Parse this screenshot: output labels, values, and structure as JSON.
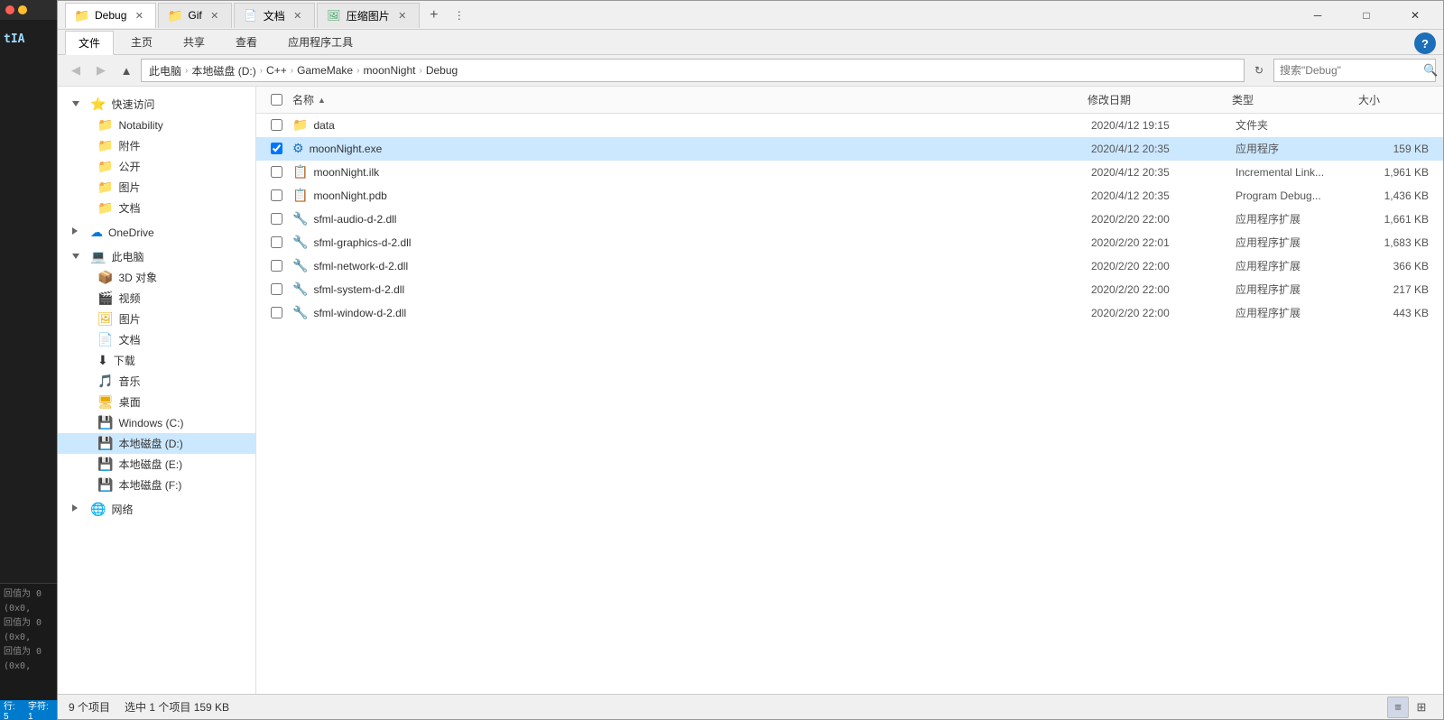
{
  "window": {
    "title": "Debug",
    "tabs": [
      {
        "label": "Debug",
        "type": "folder",
        "active": true
      },
      {
        "label": "Gif",
        "type": "folder",
        "active": false
      },
      {
        "label": "文档",
        "type": "doc",
        "active": false
      },
      {
        "label": "压缩图片",
        "type": "img",
        "active": false
      }
    ],
    "controls": {
      "minimize": "─",
      "maximize": "□",
      "close": "✕"
    }
  },
  "ribbon": {
    "tabs": [
      "文件",
      "主页",
      "共享",
      "查看",
      "应用程序工具"
    ],
    "active_tab": "文件",
    "help_icon": "?"
  },
  "address_bar": {
    "path": "此电脑 › 本地磁盘 (D:) › C++ › GameMake › moonNight › Debug",
    "path_parts": [
      "此电脑",
      "本地磁盘 (D:)",
      "C++",
      "GameMake",
      "moonNight",
      "Debug"
    ],
    "search_placeholder": "搜索\"Debug\""
  },
  "sidebar": {
    "quick_access_label": "快速访问",
    "onedrive_label": "OneDrive",
    "items": [
      {
        "label": "快速访问",
        "type": "quick-access",
        "level": 0,
        "expanded": true
      },
      {
        "label": "Notability",
        "type": "folder",
        "level": 1
      },
      {
        "label": "附件",
        "type": "folder",
        "level": 1
      },
      {
        "label": "公开",
        "type": "folder",
        "level": 1
      },
      {
        "label": "图片",
        "type": "folder",
        "level": 1
      },
      {
        "label": "文档",
        "type": "folder",
        "level": 1
      },
      {
        "label": "OneDrive",
        "type": "onedrive",
        "level": 0
      },
      {
        "label": "此电脑",
        "type": "pc",
        "level": 0,
        "expanded": true
      },
      {
        "label": "3D 对象",
        "type": "folder",
        "level": 1
      },
      {
        "label": "视频",
        "type": "folder",
        "level": 1
      },
      {
        "label": "图片",
        "type": "folder",
        "level": 1
      },
      {
        "label": "文档",
        "type": "folder",
        "level": 1
      },
      {
        "label": "下载",
        "type": "folder",
        "level": 1
      },
      {
        "label": "音乐",
        "type": "folder",
        "level": 1
      },
      {
        "label": "桌面",
        "type": "folder",
        "level": 1
      },
      {
        "label": "Windows (C:)",
        "type": "drive",
        "level": 1
      },
      {
        "label": "本地磁盘 (D:)",
        "type": "drive",
        "level": 1,
        "selected": true
      },
      {
        "label": "本地磁盘 (E:)",
        "type": "drive",
        "level": 1
      },
      {
        "label": "本地磁盘 (F:)",
        "type": "drive",
        "level": 1
      },
      {
        "label": "网络",
        "type": "network",
        "level": 0
      }
    ]
  },
  "file_list": {
    "columns": [
      "名称",
      "修改日期",
      "类型",
      "大小"
    ],
    "files": [
      {
        "name": "data",
        "date": "2020/4/12 19:15",
        "type": "文件夹",
        "size": "",
        "icon": "folder",
        "selected": false,
        "checked": false
      },
      {
        "name": "moonNight.exe",
        "date": "2020/4/12 20:35",
        "type": "应用程序",
        "size": "159 KB",
        "icon": "exe",
        "selected": true,
        "checked": true
      },
      {
        "name": "moonNight.ilk",
        "date": "2020/4/12 20:35",
        "type": "Incremental Link...",
        "size": "1,961 KB",
        "icon": "ilk",
        "selected": false,
        "checked": false
      },
      {
        "name": "moonNight.pdb",
        "date": "2020/4/12 20:35",
        "type": "Program Debug...",
        "size": "1,436 KB",
        "icon": "pdb",
        "selected": false,
        "checked": false
      },
      {
        "name": "sfml-audio-d-2.dll",
        "date": "2020/2/20 22:00",
        "type": "应用程序扩展",
        "size": "1,661 KB",
        "icon": "dll",
        "selected": false,
        "checked": false
      },
      {
        "name": "sfml-graphics-d-2.dll",
        "date": "2020/2/20 22:01",
        "type": "应用程序扩展",
        "size": "1,683 KB",
        "icon": "dll",
        "selected": false,
        "checked": false
      },
      {
        "name": "sfml-network-d-2.dll",
        "date": "2020/2/20 22:00",
        "type": "应用程序扩展",
        "size": "366 KB",
        "icon": "dll",
        "selected": false,
        "checked": false
      },
      {
        "name": "sfml-system-d-2.dll",
        "date": "2020/2/20 22:00",
        "type": "应用程序扩展",
        "size": "217 KB",
        "icon": "dll",
        "selected": false,
        "checked": false
      },
      {
        "name": "sfml-window-d-2.dll",
        "date": "2020/2/20 22:00",
        "type": "应用程序扩展",
        "size": "443 KB",
        "icon": "dll",
        "selected": false,
        "checked": false
      }
    ]
  },
  "status_bar": {
    "item_count": "9 个项目",
    "selected_info": "选中 1 个项目  159 KB"
  },
  "editor": {
    "text_content": "tIA",
    "bottom_lines": [
      "回值为 0 (0x0,",
      "回值为 0 (0x0,",
      "回值为 0 (0x0,"
    ],
    "status_row": "行: 5",
    "status_col": "字符: 1"
  },
  "colors": {
    "accent": "#0078d7",
    "folder": "#e8a900",
    "selected_bg": "#cce8ff",
    "hover_bg": "#e8f0fe",
    "ribbon_active": "#fff",
    "title_bg": "#f0f0f0"
  }
}
